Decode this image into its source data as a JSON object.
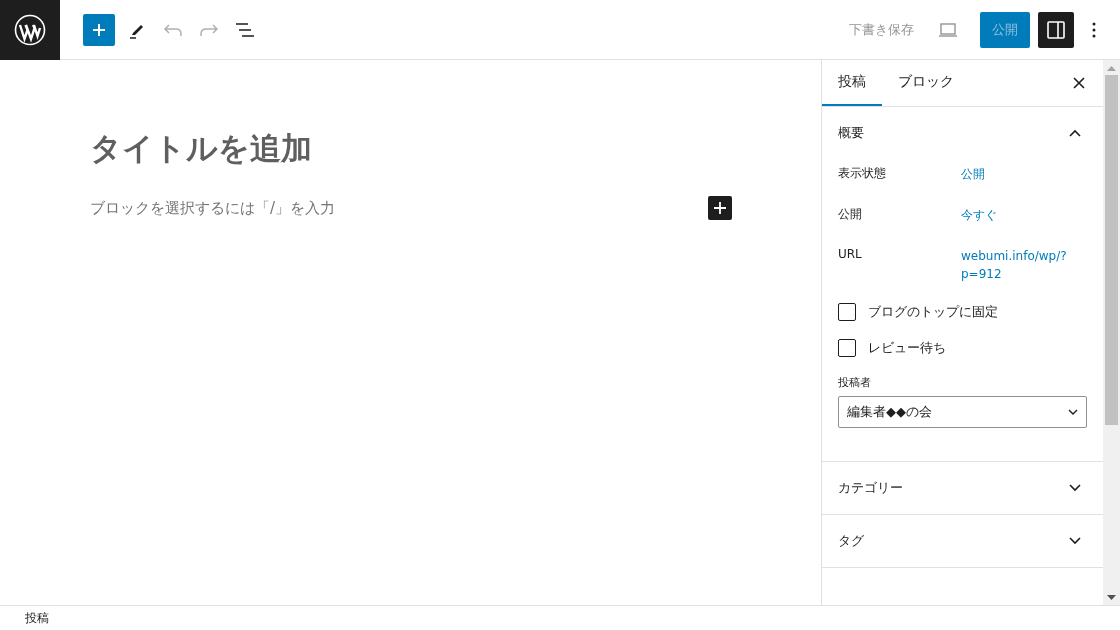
{
  "toolbar": {
    "tools": [
      {
        "kind": "add",
        "disabled": false
      },
      {
        "kind": "edit",
        "disabled": false
      },
      {
        "kind": "undo",
        "disabled": true
      },
      {
        "kind": "redo",
        "disabled": true
      },
      {
        "kind": "outline",
        "disabled": false
      }
    ],
    "save_draft": "下書き保存",
    "publish": {
      "label": "公開",
      "disabled": true
    },
    "settings_pressed": true
  },
  "editor": {
    "title_placeholder": "タイトルを追加",
    "block_placeholder": "ブロックを選択するには「/」を入力"
  },
  "sidebar": {
    "tabs": [
      {
        "label": "投稿",
        "selected": true
      },
      {
        "label": "ブロック",
        "selected": false
      }
    ],
    "panels": [
      {
        "title": "概要",
        "expanded": true,
        "rows": [
          {
            "label": "表示状態",
            "value": "公開"
          },
          {
            "label": "公開",
            "value": "今すぐ"
          },
          {
            "label": "URL",
            "value": "webumi.info/wp/?p=912"
          }
        ],
        "checkboxes": [
          {
            "label": "ブログのトップに固定",
            "checked": false
          },
          {
            "label": "レビュー待ち",
            "checked": false
          }
        ],
        "author": {
          "label": "投稿者",
          "value": "編集者◆◆の会"
        }
      },
      {
        "title": "カテゴリー",
        "expanded": false
      },
      {
        "title": "タグ",
        "expanded": false
      }
    ]
  },
  "status_bar": "投稿"
}
